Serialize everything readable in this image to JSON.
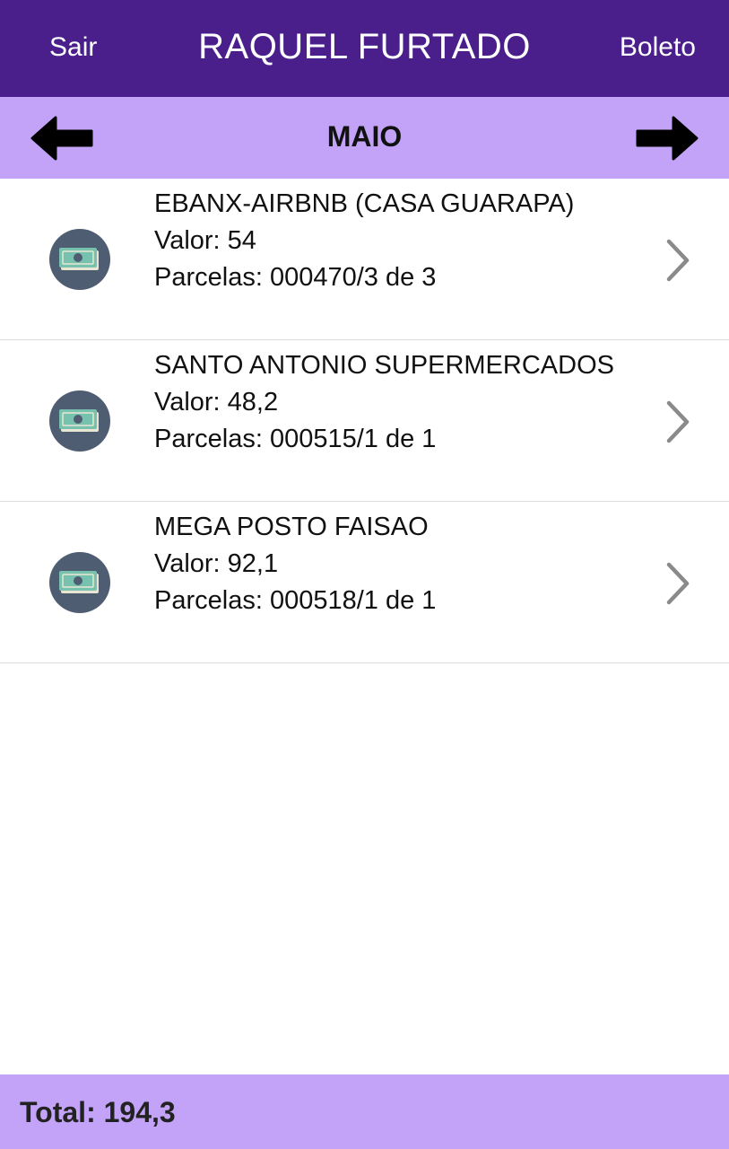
{
  "header": {
    "left_button": "Sair",
    "title": "RAQUEL FURTADO",
    "right_button": "Boleto"
  },
  "month_nav": {
    "month": "MAIO",
    "prev_icon": "arrow-left-icon",
    "next_icon": "arrow-right-icon"
  },
  "transactions": [
    {
      "merchant": "EBANX-AIRBNB (CASA GUARAPA)",
      "valor": "Valor: 54",
      "parcelas": "Parcelas: 000470/3 de 3",
      "icon": "money-bill-icon"
    },
    {
      "merchant": "SANTO ANTONIO SUPERMERCADOS",
      "valor": "Valor: 48,2",
      "parcelas": "Parcelas: 000515/1 de 1",
      "icon": "money-bill-icon"
    },
    {
      "merchant": "MEGA POSTO FAISAO",
      "valor": "Valor: 92,1",
      "parcelas": "Parcelas: 000518/1 de 1",
      "icon": "money-bill-icon"
    }
  ],
  "footer": {
    "total": "Total: 194,3"
  },
  "colors": {
    "header_bg": "#4a1f8c",
    "bar_bg": "#c2a3f8",
    "icon_circle": "#4f5d73",
    "bill": "#76c2af",
    "chevron": "#8a8a8a"
  }
}
